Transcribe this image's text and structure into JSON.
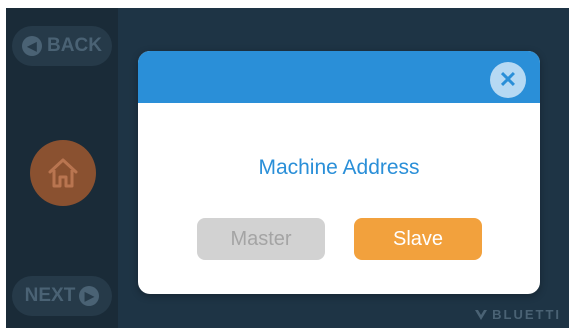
{
  "sidebar": {
    "back_label": "BACK",
    "next_label": "NEXT"
  },
  "brand": {
    "logo_text": "BLUETTI"
  },
  "dialog": {
    "title": "Machine Address",
    "master_label": "Master",
    "slave_label": "Slave",
    "close_glyph": "✕"
  },
  "colors": {
    "accent_blue": "#2a8fd8",
    "selected_orange": "#f2a13d",
    "disabled_gray": "#d2d2d2",
    "background_navy": "#1e3445"
  },
  "icons": {
    "back": "arrow-left-icon",
    "next": "arrow-right-icon",
    "home": "home-icon",
    "close": "close-icon",
    "logo": "bluetti-logo-icon"
  }
}
